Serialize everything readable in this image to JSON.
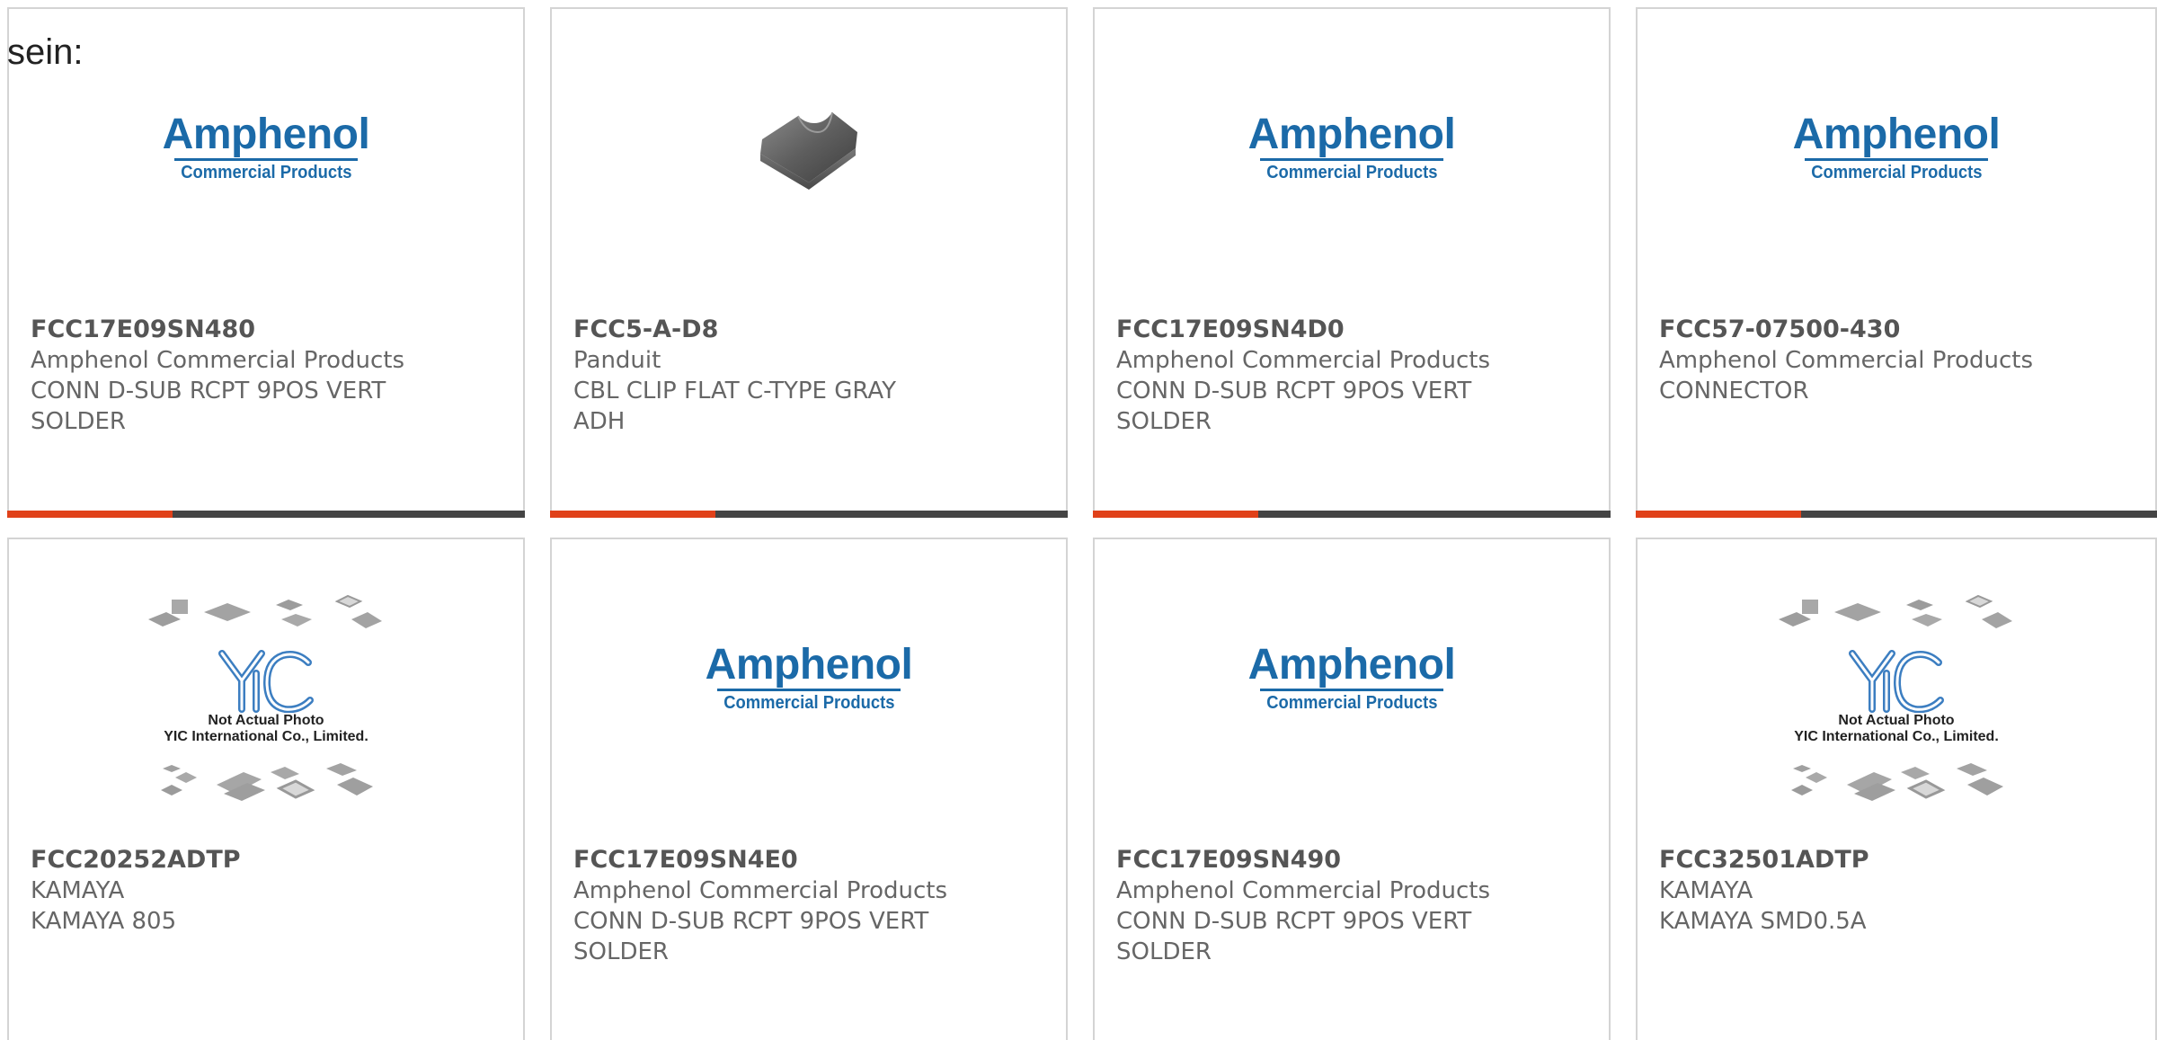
{
  "lead_text": "sein:",
  "logo": {
    "brand": "Amphenol",
    "division": "Commercial Products"
  },
  "placeholder": {
    "line1": "Not Actual Photo",
    "line2": "YIC International Co., Limited."
  },
  "colors": {
    "accent": "#e0411a",
    "bar": "#444444",
    "brand_blue": "#1b6aa8"
  },
  "products": [
    {
      "part": "FCC17E09SN480",
      "maker": "Amphenol Commercial Products",
      "desc1": "CONN D-SUB RCPT 9POS VERT",
      "desc2": "SOLDER",
      "image": "amphenol-logo"
    },
    {
      "part": "FCC5-A-D8",
      "maker": "Panduit",
      "desc1": "CBL CLIP FLAT C-TYPE GRAY",
      "desc2": "ADH",
      "image": "cable-clip-photo"
    },
    {
      "part": "FCC17E09SN4D0",
      "maker": "Amphenol Commercial Products",
      "desc1": "CONN D-SUB RCPT 9POS VERT",
      "desc2": "SOLDER",
      "image": "amphenol-logo"
    },
    {
      "part": "FCC57-07500-430",
      "maker": "Amphenol Commercial Products",
      "desc1": "CONNECTOR",
      "desc2": "",
      "image": "amphenol-logo"
    },
    {
      "part": "FCC20252ADTP",
      "maker": "KAMAYA",
      "desc1": "KAMAYA 805",
      "desc2": "",
      "image": "yic-placeholder"
    },
    {
      "part": "FCC17E09SN4E0",
      "maker": "Amphenol Commercial Products",
      "desc1": "CONN D-SUB RCPT 9POS VERT",
      "desc2": "SOLDER",
      "image": "amphenol-logo"
    },
    {
      "part": "FCC17E09SN490",
      "maker": "Amphenol Commercial Products",
      "desc1": "CONN D-SUB RCPT 9POS VERT",
      "desc2": "SOLDER",
      "image": "amphenol-logo"
    },
    {
      "part": "FCC32501ADTP",
      "maker": "KAMAYA",
      "desc1": "KAMAYA SMD0.5A",
      "desc2": "",
      "image": "yic-placeholder"
    }
  ]
}
